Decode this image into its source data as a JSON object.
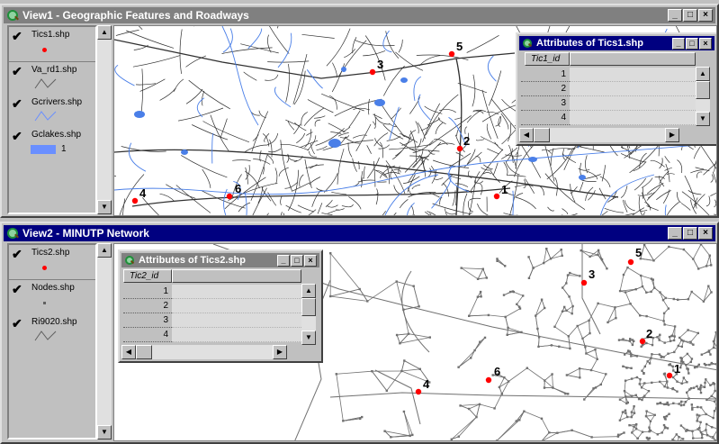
{
  "view1": {
    "title": "View1 - Geographic Features and Roadways",
    "legend": [
      {
        "name": "Tics1.shp",
        "symbol": "red-point"
      },
      {
        "name": "Va_rd1.shp",
        "symbol": "line"
      },
      {
        "name": "Gcrivers.shp",
        "symbol": "blue-line"
      },
      {
        "name": "Gclakes.shp",
        "symbol": "blue-fill",
        "value": "1"
      }
    ],
    "tics": [
      {
        "label": "1"
      },
      {
        "label": "2"
      },
      {
        "label": "3"
      },
      {
        "label": "4"
      },
      {
        "label": "5"
      },
      {
        "label": "6"
      }
    ],
    "attributes": {
      "title": "Attributes of Tics1.shp",
      "column": "Tic1_id",
      "rows": [
        "1",
        "2",
        "3",
        "4"
      ]
    }
  },
  "view2": {
    "title": "View2 - MINUTP Network",
    "legend": [
      {
        "name": "Tics2.shp",
        "symbol": "red-point"
      },
      {
        "name": "Nodes.shp",
        "symbol": "gray-point"
      },
      {
        "name": "Ri9020.shp",
        "symbol": "line"
      }
    ],
    "tics": [
      {
        "label": "1"
      },
      {
        "label": "2"
      },
      {
        "label": "3"
      },
      {
        "label": "4"
      },
      {
        "label": "5"
      },
      {
        "label": "6"
      }
    ],
    "attributes": {
      "title": "Attributes of Tics2.shp",
      "column": "Tic2_id",
      "rows": [
        "1",
        "2",
        "3",
        "4"
      ]
    }
  },
  "window_buttons": {
    "minimize": "_",
    "maximize": "□",
    "close": "×"
  },
  "colors": {
    "active_title": "#000080",
    "inactive_title": "#808080",
    "tic_point": "#ff0000",
    "water": "#4a7fe8"
  }
}
